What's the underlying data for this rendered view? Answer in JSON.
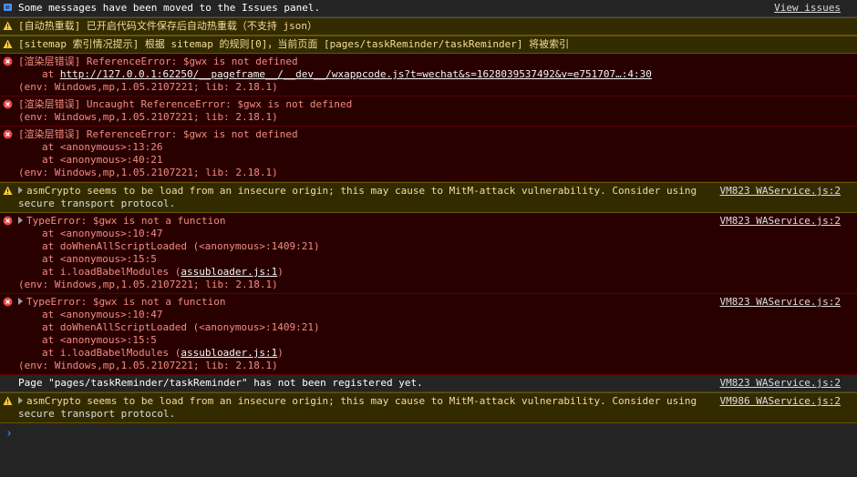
{
  "rows": [
    {
      "type": "info",
      "icon": "message-icon",
      "lines": [
        "Some messages have been moved to the Issues panel."
      ],
      "source": "View issues"
    },
    {
      "type": "warn",
      "icon": "warning-icon",
      "lines": [
        "[自动热重载] 已开启代码文件保存后自动热重载（不支持 json）"
      ]
    },
    {
      "type": "warn",
      "icon": "warning-icon",
      "lines": [
        "[sitemap 索引情况提示] 根据 sitemap 的规则[0]，当前页面 [pages/taskReminder/taskReminder] 将被索引"
      ]
    },
    {
      "type": "err",
      "icon": "error-icon",
      "lines": [
        "[渲染层错误] ReferenceError: $gwx is not defined"
      ],
      "at_prefix": "at ",
      "link": "http://127.0.0.1:62250/__pageframe__/__dev__/wxappcode.js?t=wechat&s=1628039537492&v=e751707…:4:30",
      "env": "(env: Windows,mp,1.05.2107221; lib: 2.18.1)"
    },
    {
      "type": "err",
      "icon": "error-icon",
      "lines": [
        "[渲染层错误] Uncaught ReferenceError: $gwx is not defined",
        "(env: Windows,mp,1.05.2107221; lib: 2.18.1)"
      ]
    },
    {
      "type": "err",
      "icon": "error-icon",
      "lines": [
        "[渲染层错误] ReferenceError: $gwx is not defined"
      ],
      "stack": [
        "at <anonymous>:13:26",
        "at <anonymous>:40:21"
      ],
      "env": "(env: Windows,mp,1.05.2107221; lib: 2.18.1)"
    },
    {
      "type": "warn",
      "icon": "warning-icon",
      "lines": [
        "asmCrypto seems to be load from an insecure origin; this may cause to MitM-attack vulnerability. Consider using",
        "secure transport protocol."
      ],
      "source": "VM823 WAService.js:2"
    },
    {
      "type": "err",
      "icon": "error-icon",
      "lines": [
        "TypeError: $gwx is not a function"
      ],
      "stack": [
        "at <anonymous>:10:47",
        "at doWhenAllScriptLoaded (<anonymous>:1409:21)",
        "at <anonymous>:15:5"
      ],
      "last_stack_prefix": "at i.loadBabelModules (",
      "last_stack_link": "assubloader.js:1",
      "last_stack_suffix": ")",
      "env": "(env: Windows,mp,1.05.2107221; lib: 2.18.1)",
      "source": "VM823 WAService.js:2"
    },
    {
      "type": "err",
      "icon": "error-icon",
      "lines": [
        "TypeError: $gwx is not a function"
      ],
      "stack": [
        "at <anonymous>:10:47",
        "at doWhenAllScriptLoaded (<anonymous>:1409:21)",
        "at <anonymous>:15:5"
      ],
      "last_stack_prefix": "at i.loadBabelModules (",
      "last_stack_link": "assubloader.js:1",
      "last_stack_suffix": ")",
      "env": "(env: Windows,mp,1.05.2107221; lib: 2.18.1)",
      "source": "VM823 WAService.js:2"
    },
    {
      "type": "log",
      "lines": [
        "Page \"pages/taskReminder/taskReminder\" has not been registered yet."
      ],
      "source": "VM823 WAService.js:2"
    },
    {
      "type": "warn",
      "icon": "warning-icon",
      "lines": [
        "asmCrypto seems to be load from an insecure origin; this may cause to MitM-attack vulnerability. Consider using",
        "secure transport protocol."
      ],
      "source": "VM986 WAService.js:2"
    }
  ],
  "prompt": "›",
  "colors": {
    "warning": "#f2c744",
    "error": "#e04545",
    "info": "#4d90fe"
  }
}
